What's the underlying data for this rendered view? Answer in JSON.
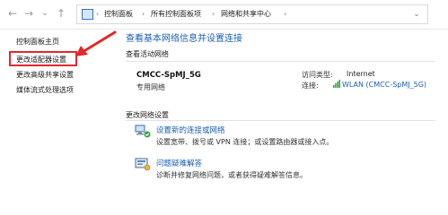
{
  "nav": {
    "back_icon": "←",
    "forward_icon": "→",
    "dropdown_icon": "⌄",
    "up_icon": "↑",
    "breadcrumb_sep": "›",
    "breadcrumbs": [
      "控制面板",
      "所有控制面板项",
      "网络和共享中心"
    ],
    "expand_icon": "⌄"
  },
  "sidebar": {
    "items": [
      {
        "label": "控制面板主页"
      },
      {
        "label": "更改适配器设置"
      },
      {
        "label": "更改高级共享设置"
      },
      {
        "label": "媒体流式处理选项"
      }
    ]
  },
  "main": {
    "title": "查看基本网络信息并设置连接",
    "active_networks_heading": "查看活动网络",
    "network": {
      "name": "CMCC-SpMJ_5G",
      "type": "专用网络",
      "access_type_label": "访问类型:",
      "access_type_value": "Internet",
      "connection_label": "连接:",
      "connection_value": "WLAN (CMCC-SpMJ_5G)"
    },
    "change_settings_heading": "更改网络设置",
    "tasks": [
      {
        "title": "设置新的连接或网络",
        "description": "设置宽带、拨号或 VPN 连接；或设置路由器或接入点。"
      },
      {
        "title": "问题疑难解答",
        "description": "诊断并修复网络问题，或者获得疑难解答信息。"
      }
    ]
  },
  "colors": {
    "link": "#1a5fb4",
    "highlight_border": "#e02a2a",
    "annotation_arrow": "#e02a2a"
  }
}
